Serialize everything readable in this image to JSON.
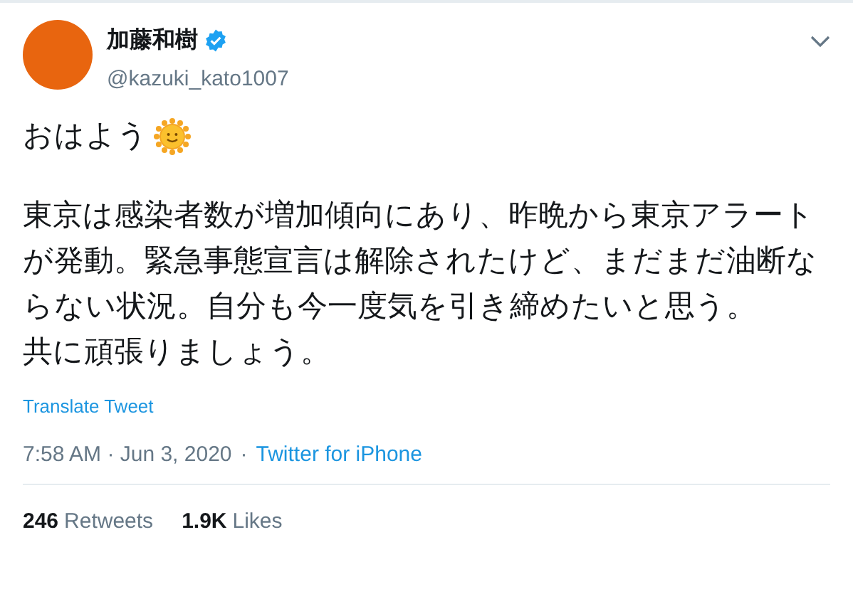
{
  "author": {
    "name": "加藤和樹",
    "verified": true,
    "handle": "@kazuki_kato1007"
  },
  "tweet": {
    "greeting": "おはよう",
    "body": [
      "東京は感染者数が増加傾向にあり、昨晩から東京アラートが発動。緊急事態宣言は解除されたけど、まだまだ油断ならない状況。自分も今一度気を引き締めたいと思う。",
      "共に頑張りましょう。"
    ]
  },
  "translate_link": "Translate Tweet",
  "meta": {
    "timestamp": "7:58 AM · Jun 3, 2020",
    "separator": "·",
    "source": "Twitter for iPhone"
  },
  "stats": [
    {
      "count": "246",
      "label": "Retweets"
    },
    {
      "count": "1.9K",
      "label": "Likes"
    }
  ]
}
